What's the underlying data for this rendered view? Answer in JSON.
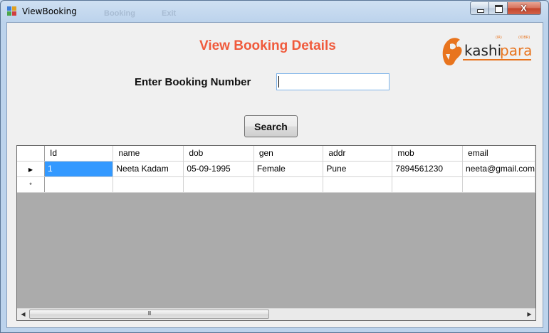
{
  "window": {
    "title": "ViewBooking",
    "ghost_menu": [
      "Booking",
      "Exit"
    ],
    "controls": {
      "close_label": "X"
    }
  },
  "form": {
    "heading": "View Booking Details",
    "heading_color": "#f05a3c",
    "booking_label": "Enter Booking Number",
    "booking_value": "",
    "search_label": "Search"
  },
  "logo": {
    "text": "kashipara",
    "small_left": "(IR)",
    "small_right": "(IOBR)",
    "color": "#e8741e"
  },
  "grid": {
    "columns": [
      "Id",
      "name",
      "dob",
      "gen",
      "addr",
      "mob",
      "email"
    ],
    "rows": [
      [
        "1",
        "Neeta Kadam",
        "05-09-1995",
        "Female",
        "Pune",
        "7894561230",
        "neeta@gmail.com"
      ]
    ],
    "current_row_marker": "▶",
    "new_row_marker": "*",
    "scroll_grip": "III"
  }
}
